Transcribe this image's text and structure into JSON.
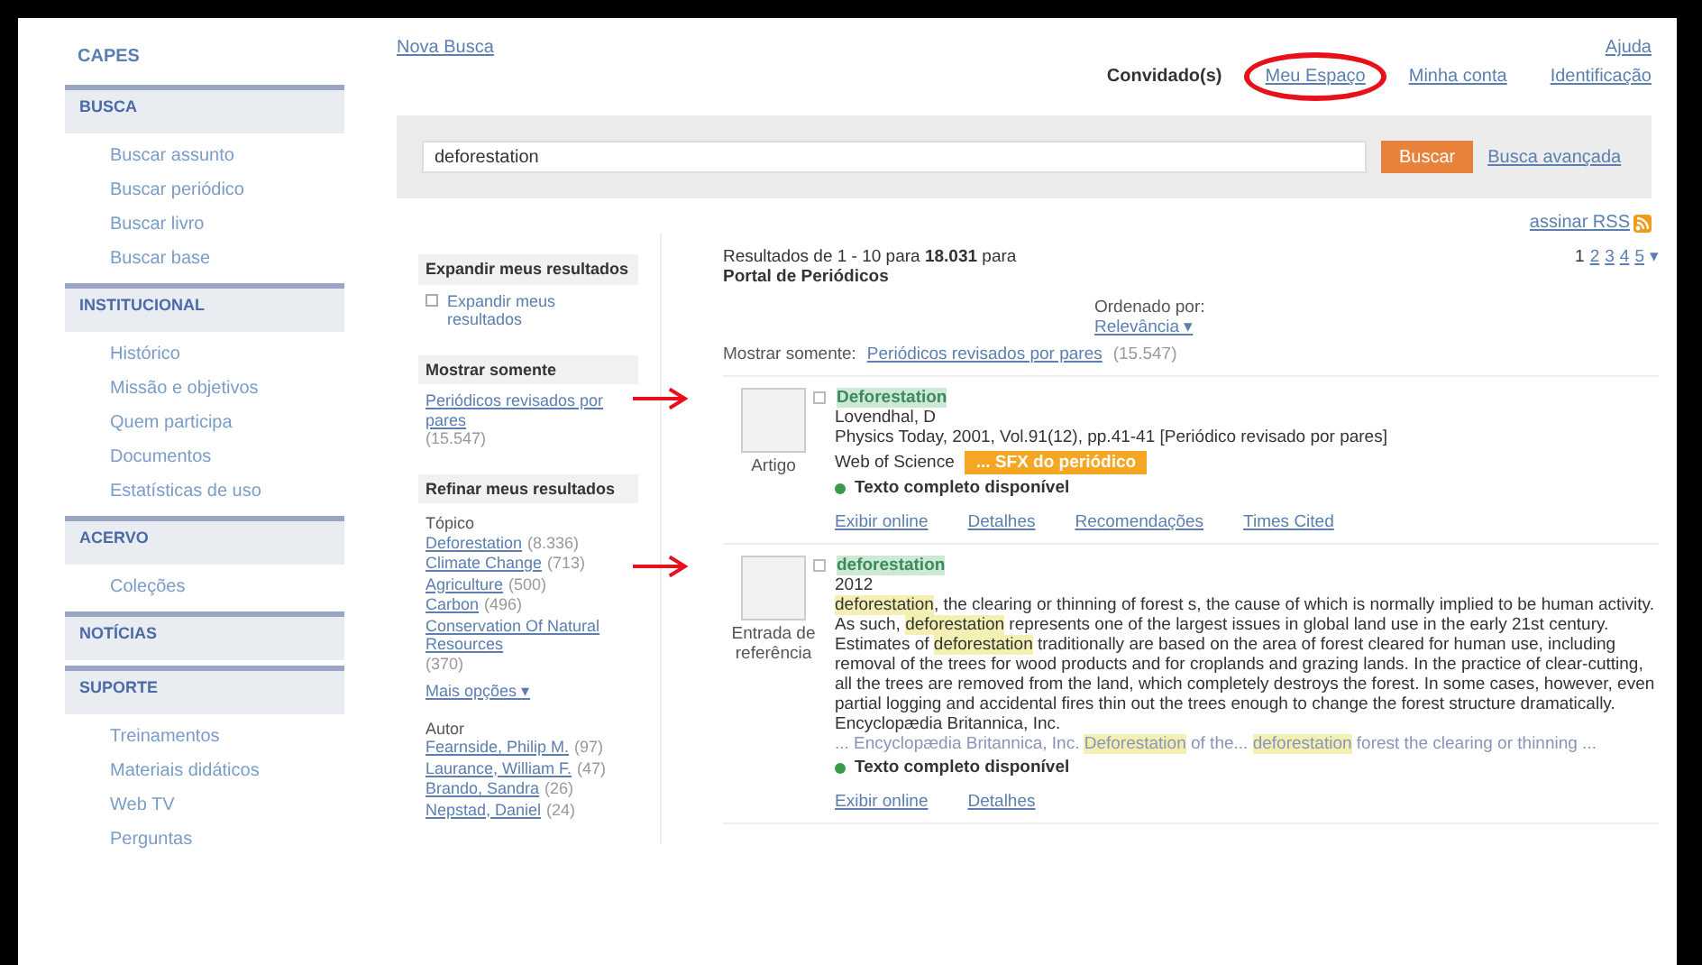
{
  "sidebar": {
    "logo": "CAPES",
    "sections": [
      {
        "title": "BUSCA",
        "items": [
          "Buscar assunto",
          "Buscar periódico",
          "Buscar livro",
          "Buscar base"
        ]
      },
      {
        "title": "INSTITUCIONAL",
        "items": [
          "Histórico",
          "Missão e objetivos",
          "Quem participa",
          "Documentos",
          "Estatísticas de uso"
        ]
      },
      {
        "title": "ACERVO",
        "items": [
          "Coleções"
        ]
      },
      {
        "title": "NOTÍCIAS"
      },
      {
        "title": "SUPORTE",
        "items": [
          "Treinamentos",
          "Materiais didáticos",
          "Web TV",
          "Perguntas"
        ]
      }
    ]
  },
  "top_bar": {
    "new_search": "Nova Busca",
    "help": "Ajuda",
    "user": "Convidado(s)",
    "links": [
      {
        "label": "Meu Espaço",
        "circled": true
      },
      {
        "label": "Minha conta",
        "circled": false
      },
      {
        "label": "Identificação",
        "circled": false
      }
    ]
  },
  "search": {
    "value": "deforestation",
    "button": "Buscar",
    "advanced": "Busca avançada",
    "rss": "assinar RSS"
  },
  "facets": [
    {
      "title": "Expandir meus resultados",
      "kind": "checkbox",
      "label": "Expandir meus resultados",
      "checked": false
    },
    {
      "title": "Mostrar somente",
      "kind": "links",
      "groups": [
        {
          "items": [
            {
              "label": "Periódicos revisados por pares",
              "count": "(15.547)"
            }
          ]
        }
      ]
    },
    {
      "title": "Refinar meus resultados",
      "kind": "links",
      "groups": [
        {
          "heading": "Tópico",
          "items": [
            {
              "label": "Deforestation",
              "count": "(8.336)"
            },
            {
              "label": "Climate Change",
              "count": "(713)"
            },
            {
              "label": "Agriculture",
              "count": "(500)"
            },
            {
              "label": "Carbon",
              "count": "(496)"
            },
            {
              "label": "Conservation Of Natural Resources",
              "count": "(370)"
            }
          ],
          "more": "Mais opções ▾"
        },
        {
          "heading": "Autor",
          "items": [
            {
              "label": "Fearnside, Philip M.",
              "count": "(97)"
            },
            {
              "label": "Laurance, William F.",
              "count": "(47)"
            },
            {
              "label": "Brando, Sandra",
              "count": "(26)"
            },
            {
              "label": "Nepstad, Daniel",
              "count": "(24)"
            }
          ]
        }
      ]
    }
  ],
  "results": {
    "summary": "Resultados de 1 - 10 para **18.031** para",
    "source": "Portal de Periódicos",
    "sort_label": "Ordenado por:",
    "sort_value": "Relevância ▾",
    "filter_label": "Mostrar somente:",
    "filter_link": "Periódicos revisados por pares",
    "filter_count": "(15.547)",
    "pages": [
      {
        "label": "1",
        "selected": true
      },
      {
        "label": "2",
        "selected": false
      },
      {
        "label": "3",
        "selected": false
      },
      {
        "label": "4",
        "selected": false
      },
      {
        "label": "5",
        "selected": false
      }
    ],
    "pages_more": "▾",
    "items": [
      {
        "type": "Artigo",
        "arrow": true,
        "checked": false,
        "title": "Deforestation",
        "lines": [
          "Lovendhal, D",
          "Physics Today, 2001, Vol.91(12), pp.41-41 [Periódico revisado por pares]"
        ],
        "database": "Web of Science",
        "badge": "... SFX do periódico",
        "availability": "Texto completo disponível",
        "links": [
          "Exibir online",
          "Detalhes",
          "Recomendações",
          "Times Cited"
        ]
      },
      {
        "type": "Entrada de referência",
        "arrow": true,
        "checked": false,
        "title": "deforestation",
        "lines": [
          "2012"
        ],
        "abstract": [
          {
            "text": "deforestation",
            "highlighted": true
          },
          {
            "text": ", the clearing or thinning of forest s, the cause of which is normally implied to be human activity. As such, ",
            "highlighted": false
          },
          {
            "text": "deforestation",
            "highlighted": true
          },
          {
            "text": " represents one of the largest issues in global land use in the early 21st century. Estimates of ",
            "highlighted": false
          },
          {
            "text": "deforestation",
            "highlighted": true
          },
          {
            "text": " traditionally are based on the area of forest cleared for human use, including removal of the trees for wood products and for croplands and grazing lands. In the practice of clear-cutting, all the trees are removed from the land, which completely destroys the forest. In some cases, however, even partial logging and accidental fires thin out the trees enough to change the forest structure dramatically. Encyclopædia Britannica, Inc.",
            "highlighted": false
          }
        ],
        "snippet": [
          {
            "text": "... Encyclopædia Britannica, Inc. ",
            "highlighted": false
          },
          {
            "text": "Deforestation",
            "highlighted": true
          },
          {
            "text": " of the... ",
            "highlighted": false
          },
          {
            "text": "deforestation",
            "highlighted": true
          },
          {
            "text": " forest the clearing or thinning ...",
            "highlighted": false
          }
        ],
        "availability": "Texto completo disponível",
        "links": [
          "Exibir online",
          "Detalhes"
        ]
      }
    ]
  }
}
